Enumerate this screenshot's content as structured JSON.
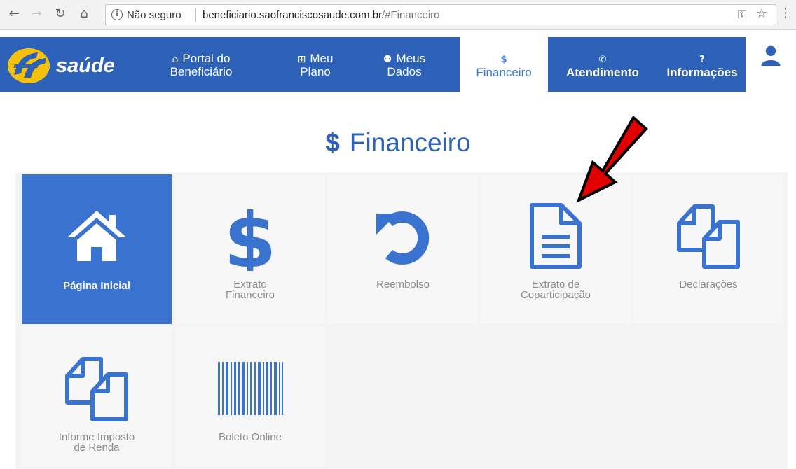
{
  "browser": {
    "security_label": "Não seguro",
    "url_host": "beneficiario.saofranciscosaude.com.br",
    "url_path": "/#Financeiro"
  },
  "brand": {
    "logo_mark": "SF",
    "logo_text": "saúde"
  },
  "nav": {
    "items": [
      {
        "icon": "home-icon",
        "line1": "Portal do",
        "line2": "Beneficiário"
      },
      {
        "icon": "medical-kit-icon",
        "line1": "Meu",
        "line2": "Plano"
      },
      {
        "icon": "add-user-icon",
        "line1": "Meus",
        "line2": "Dados"
      },
      {
        "icon": "dollar-icon",
        "line1": "$",
        "line2": "Financeiro",
        "active": true
      },
      {
        "icon": "phone-icon",
        "line1": "✆",
        "line2": "Atendimento"
      },
      {
        "icon": "question-icon",
        "line1": "?",
        "line2": "Informações"
      }
    ]
  },
  "page": {
    "title_icon": "$",
    "title": "Financeiro"
  },
  "tiles": [
    {
      "icon": "home-icon",
      "label": "Página Inicial",
      "active": true
    },
    {
      "icon": "dollar-icon",
      "label": "Extrato\nFinanceiro"
    },
    {
      "icon": "undo-icon",
      "label": "Reembolso"
    },
    {
      "icon": "document-icon",
      "label": "Extrato de\nCoparticipação"
    },
    {
      "icon": "copy-icon",
      "label": "Declarações"
    },
    {
      "icon": "copy-icon",
      "label": "Informe Imposto\nde Renda"
    },
    {
      "icon": "barcode-icon",
      "label": "Boleto Online"
    }
  ],
  "colors": {
    "brand_blue": "#2d62b8",
    "tile_active": "#3a73cf",
    "icon_blue": "#3a73cf",
    "annotation_arrow": "#e00000"
  }
}
